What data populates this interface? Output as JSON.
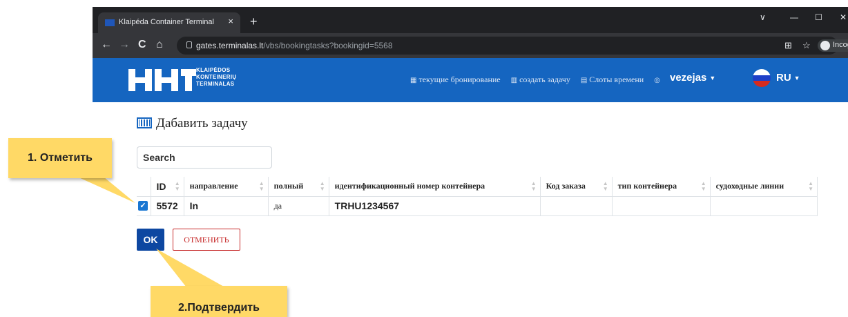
{
  "browser": {
    "tab_title": "Klaipéda Container Terminal",
    "tab_close": "×",
    "new_tab": "+",
    "url_host": "gates.terminalas.lt",
    "url_path": "/vbs/bookingtasks?bookingid=5568",
    "incognito_label": "Incognito",
    "back": "←",
    "forward": "→",
    "reload": "C",
    "home": "⌂",
    "win_minimize": "—",
    "win_maximize": "☐",
    "win_close": "✕",
    "win_tabsearch": "∨"
  },
  "header": {
    "logo_lines": [
      "KLAIPĖDOS",
      "KONTEINERIŲ",
      "TERMINALAS"
    ],
    "nav": [
      {
        "icon": "calendar-icon",
        "label": "текущие бронирование"
      },
      {
        "icon": "list-icon",
        "label": "создать задачу"
      },
      {
        "icon": "clock-icon",
        "label": "Слоты времени"
      }
    ],
    "user_name": "vezejas",
    "language": "RU"
  },
  "page": {
    "title": "Дабавить задачу",
    "search_placeholder": "Search"
  },
  "table": {
    "columns": [
      "ID",
      "направление",
      "полный",
      "идентификационный номер контейнера",
      "Код заказа",
      "тип контейнера",
      "судоходные линии"
    ],
    "rows": [
      {
        "checked": true,
        "id": "5572",
        "direction": "In",
        "full": "да",
        "container": "TRHU1234567",
        "order": "",
        "type": "",
        "lines": ""
      }
    ]
  },
  "buttons": {
    "ok": "OK",
    "cancel": "ОТМЕНИТЬ"
  },
  "callouts": {
    "step1": "1. Отметить",
    "step2": "2.Подтвердить"
  },
  "colors": {
    "header_blue": "#1565c0",
    "ok_blue": "#0d47a1",
    "cancel_red": "#c62828",
    "callout_yellow": "#ffd966"
  }
}
